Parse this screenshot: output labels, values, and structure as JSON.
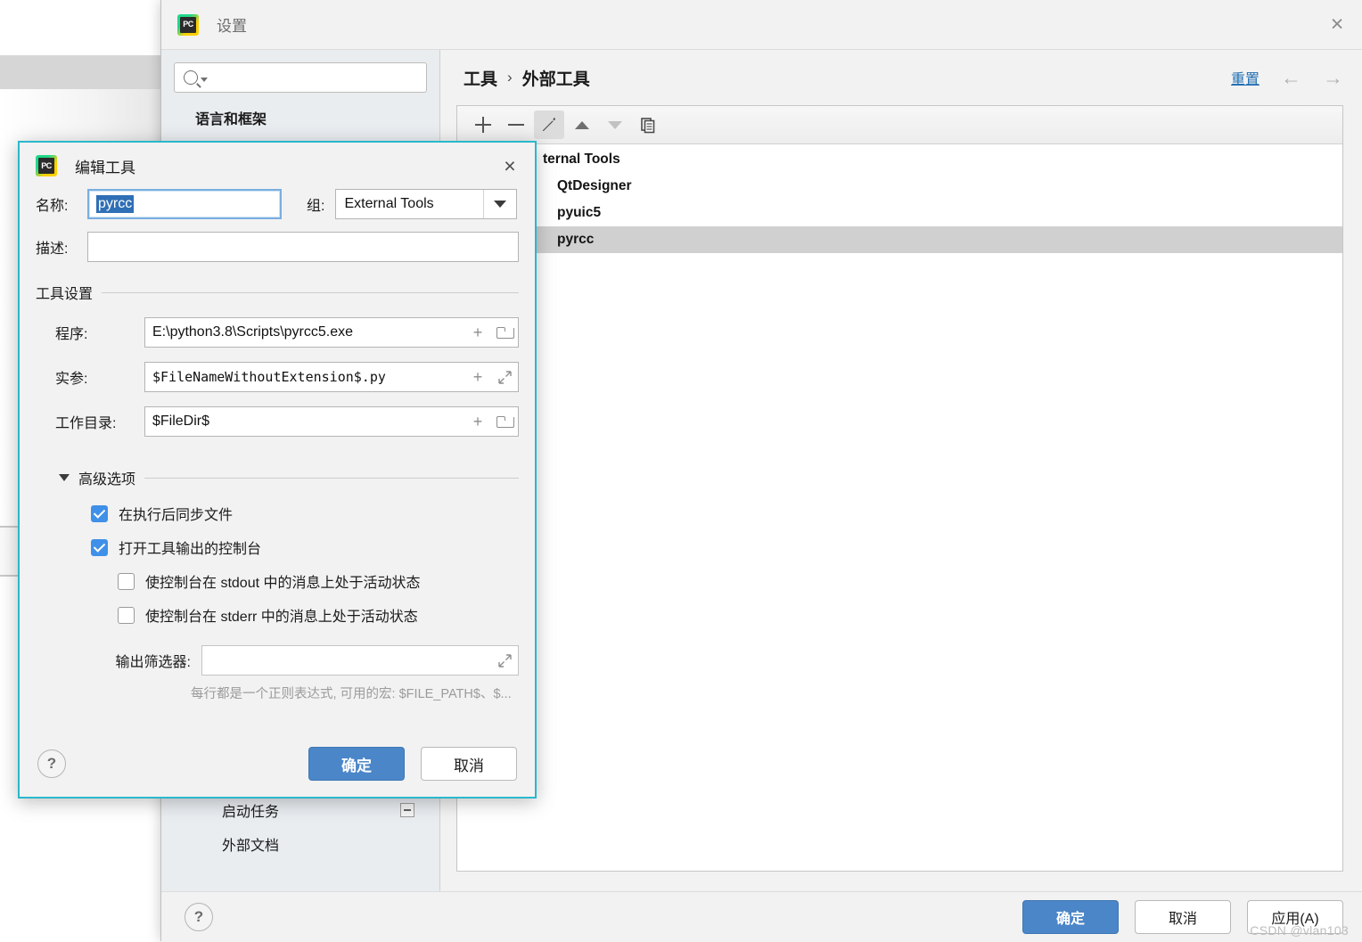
{
  "settings_window": {
    "title": "设置",
    "logo_text": "PC",
    "close_icon": "×",
    "search": {
      "value": "",
      "placeholder": ""
    },
    "sidebar": {
      "heading": "语言和框架",
      "bottom_items": [
        {
          "label": "启动任务",
          "has_collapse_box": true
        },
        {
          "label": "外部文档",
          "has_collapse_box": false
        }
      ]
    },
    "breadcrumb": {
      "root": "工具",
      "separator": "›",
      "leaf": "外部工具"
    },
    "reset_label": "重置",
    "nav_back": "←",
    "nav_forward": "→",
    "toolbar": {
      "add": "+",
      "remove": "−",
      "edit": "pencil",
      "move_up": "▲",
      "move_down": "▼",
      "copy": "copy"
    },
    "tools_tree": [
      {
        "label": "ternal Tools",
        "level": 0,
        "selected": false
      },
      {
        "label": "QtDesigner",
        "level": 1,
        "selected": false
      },
      {
        "label": "pyuic5",
        "level": 1,
        "selected": false
      },
      {
        "label": "pyrcc",
        "level": 1,
        "selected": true
      }
    ],
    "help_label": "?",
    "footer_buttons": [
      {
        "label": "确定",
        "primary": true
      },
      {
        "label": "取消",
        "primary": false
      },
      {
        "label": "应用(A)",
        "primary": false
      }
    ],
    "watermark": "CSDN @vlan103"
  },
  "edit_dialog": {
    "title": "编辑工具",
    "logo_text": "PC",
    "close_icon": "×",
    "name_label": "名称:",
    "name_value": "pyrcc",
    "group_label": "组:",
    "group_value": "External Tools",
    "description_label": "描述:",
    "description_value": "",
    "tool_settings_title": "工具设置",
    "settings": [
      {
        "label": "程序:",
        "value": "E:\\python3.8\\Scripts\\pyrcc5.exe",
        "mono": false,
        "trailing_icon": "folder"
      },
      {
        "label": "实参:",
        "value": "$FileNameWithoutExtension$.py",
        "mono": true,
        "trailing_icon": "expand"
      },
      {
        "label": "工作目录:",
        "value": "$FileDir$",
        "mono": false,
        "trailing_icon": "folder"
      }
    ],
    "advanced_title": "高级选项",
    "checkboxes": [
      {
        "label": "在执行后同步文件",
        "checked": true,
        "indent": false
      },
      {
        "label": "打开工具输出的控制台",
        "checked": true,
        "indent": false
      },
      {
        "label": "使控制台在 stdout 中的消息上处于活动状态",
        "checked": false,
        "indent": true
      },
      {
        "label": "使控制台在 stderr 中的消息上处于活动状态",
        "checked": false,
        "indent": true
      }
    ],
    "output_filter_label": "输出筛选器:",
    "output_filter_value": "",
    "hint": "每行都是一个正则表达式, 可用的宏: $FILE_PATH$、$...",
    "help_label": "?",
    "buttons": [
      {
        "label": "确定",
        "primary": true
      },
      {
        "label": "取消",
        "primary": false
      }
    ]
  },
  "colors": {
    "accent_blue": "#4a86c8",
    "link_blue": "#2470b3",
    "dialog_border_teal": "#29b8cc",
    "selection_blue": "#2f6fb5",
    "checkbox_blue": "#3f90e8",
    "row_selected_gray": "#d0d0d0"
  }
}
